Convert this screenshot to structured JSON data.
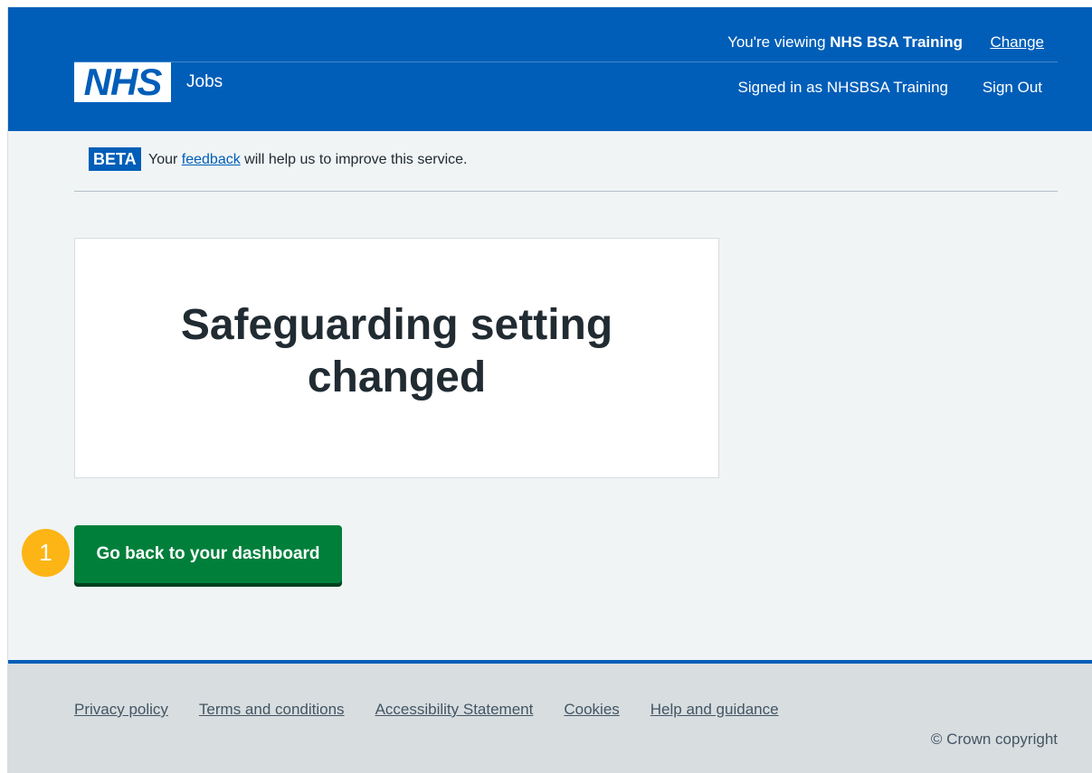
{
  "header": {
    "viewing_prefix": "You're viewing ",
    "viewing_org": "NHS BSA Training",
    "change_label": "Change",
    "logo_text": "NHS",
    "service_name": "Jobs",
    "signed_in_text": "Signed in as NHSBSA Training",
    "sign_out_label": "Sign Out"
  },
  "beta": {
    "tag": "BETA",
    "text_before": "Your ",
    "link_text": "feedback",
    "text_after": " will help us to improve this service."
  },
  "panel": {
    "title": "Safeguarding setting changed"
  },
  "action": {
    "step_number": "1",
    "button_label": "Go back to your dashboard"
  },
  "footer": {
    "links": [
      "Privacy policy",
      "Terms and conditions",
      "Accessibility Statement",
      "Cookies",
      "Help and guidance"
    ],
    "copyright": "© Crown copyright"
  },
  "colors": {
    "brand_blue": "#005eb8",
    "button_green": "#007f3b",
    "marker_yellow": "#fdb515",
    "page_background": "#f0f4f5",
    "footer_background": "#d8dde0"
  }
}
